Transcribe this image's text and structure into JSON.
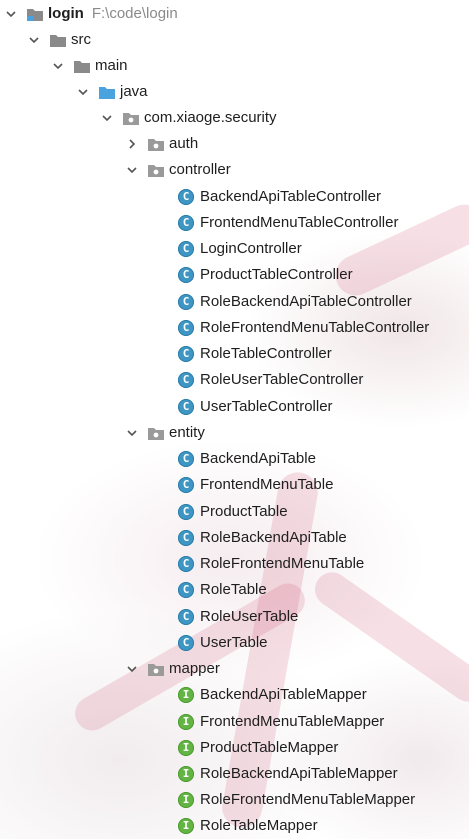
{
  "colors": {
    "class_badge": "#3e96c4",
    "interface_badge": "#62b543",
    "folder_grey": "#8a8a8a",
    "folder_blue": "#4aa3df",
    "path_text": "#8a8a8a"
  },
  "tree": {
    "root": {
      "name": "login",
      "path": "F:\\code\\login",
      "icon": "folder-icon"
    },
    "src": {
      "name": "src",
      "icon": "folder-icon"
    },
    "main": {
      "name": "main",
      "icon": "folder-icon"
    },
    "java": {
      "name": "java",
      "icon": "source-folder-icon"
    },
    "package": {
      "name": "com.xiaoge.security",
      "icon": "package-icon"
    },
    "auth": {
      "name": "auth",
      "icon": "package-icon",
      "expanded": false
    },
    "controller": {
      "name": "controller",
      "icon": "package-icon",
      "items": [
        {
          "badge": "C",
          "name": "BackendApiTableController"
        },
        {
          "badge": "C",
          "name": "FrontendMenuTableController"
        },
        {
          "badge": "C",
          "name": "LoginController"
        },
        {
          "badge": "C",
          "name": "ProductTableController"
        },
        {
          "badge": "C",
          "name": "RoleBackendApiTableController"
        },
        {
          "badge": "C",
          "name": "RoleFrontendMenuTableController"
        },
        {
          "badge": "C",
          "name": "RoleTableController"
        },
        {
          "badge": "C",
          "name": "RoleUserTableController"
        },
        {
          "badge": "C",
          "name": "UserTableController"
        }
      ]
    },
    "entity": {
      "name": "entity",
      "icon": "package-icon",
      "items": [
        {
          "badge": "C",
          "name": "BackendApiTable"
        },
        {
          "badge": "C",
          "name": "FrontendMenuTable"
        },
        {
          "badge": "C",
          "name": "ProductTable"
        },
        {
          "badge": "C",
          "name": "RoleBackendApiTable"
        },
        {
          "badge": "C",
          "name": "RoleFrontendMenuTable"
        },
        {
          "badge": "C",
          "name": "RoleTable"
        },
        {
          "badge": "C",
          "name": "RoleUserTable"
        },
        {
          "badge": "C",
          "name": "UserTable"
        }
      ]
    },
    "mapper": {
      "name": "mapper",
      "icon": "package-icon",
      "items": [
        {
          "badge": "I",
          "name": "BackendApiTableMapper"
        },
        {
          "badge": "I",
          "name": "FrontendMenuTableMapper"
        },
        {
          "badge": "I",
          "name": "ProductTableMapper"
        },
        {
          "badge": "I",
          "name": "RoleBackendApiTableMapper"
        },
        {
          "badge": "I",
          "name": "RoleFrontendMenuTableMapper"
        },
        {
          "badge": "I",
          "name": "RoleTableMapper"
        }
      ]
    }
  }
}
